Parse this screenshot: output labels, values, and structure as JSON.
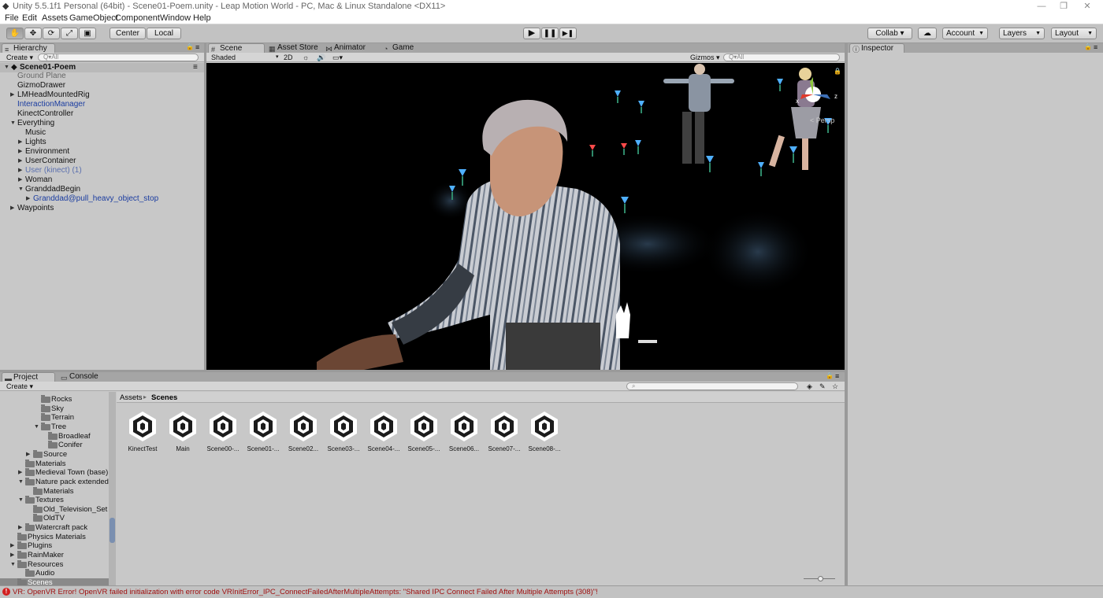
{
  "window": {
    "title": "Unity 5.5.1f1 Personal (64bit) - Scene01-Poem.unity - Leap Motion World - PC, Mac & Linux Standalone <DX11>",
    "min": "—",
    "max": "❐",
    "close": "✕"
  },
  "menu": [
    "File",
    "Edit",
    "Assets",
    "GameObject",
    "Component",
    "Window",
    "Help"
  ],
  "toolbar": {
    "pivot": "Center",
    "space": "Local",
    "collab": "Collab ▾",
    "account": "Account",
    "layers": "Layers",
    "layout": "Layout"
  },
  "hierarchy": {
    "tab": "Hierarchy",
    "create": "Create",
    "search_placeholder": "Q▾All",
    "scene": "Scene01-Poem",
    "items": [
      {
        "label": "Ground Plane",
        "indent": 0,
        "arrow": "",
        "color": "#666666"
      },
      {
        "label": "GizmoDrawer",
        "indent": 0,
        "arrow": "",
        "color": "#111111"
      },
      {
        "label": "LMHeadMountedRig",
        "indent": 0,
        "arrow": "▶",
        "color": "#111111"
      },
      {
        "label": "InteractionManager",
        "indent": 0,
        "arrow": "",
        "color": "#1a3ca0"
      },
      {
        "label": "KinectController",
        "indent": 0,
        "arrow": "",
        "color": "#111111"
      },
      {
        "label": "Everything",
        "indent": 0,
        "arrow": "▼",
        "color": "#111111"
      },
      {
        "label": "Music",
        "indent": 1,
        "arrow": "",
        "color": "#111111"
      },
      {
        "label": "Lights",
        "indent": 1,
        "arrow": "▶",
        "color": "#111111"
      },
      {
        "label": "Environment",
        "indent": 1,
        "arrow": "▶",
        "color": "#111111"
      },
      {
        "label": "UserContainer",
        "indent": 1,
        "arrow": "▶",
        "color": "#111111"
      },
      {
        "label": "User (kinect) (1)",
        "indent": 1,
        "arrow": "▶",
        "color": "#5a6fae"
      },
      {
        "label": "Woman",
        "indent": 1,
        "arrow": "▶",
        "color": "#111111"
      },
      {
        "label": "GranddadBegin",
        "indent": 1,
        "arrow": "▼",
        "color": "#111111"
      },
      {
        "label": "Granddad@pull_heavy_object_stop",
        "indent": 2,
        "arrow": "▶",
        "color": "#1a3ca0"
      },
      {
        "label": "Waypoints",
        "indent": 0,
        "arrow": "▶",
        "color": "#111111"
      }
    ]
  },
  "scene_view": {
    "tabs": [
      "Scene",
      "Asset Store",
      "Animator",
      "Game"
    ],
    "shading": "Shaded",
    "mode2d": "2D",
    "gizmos": "Gizmos",
    "search_placeholder": "Q▾All",
    "persp": "< Persp",
    "axis_z": "z",
    "axis_x": "x"
  },
  "inspector": {
    "tab": "Inspector"
  },
  "project": {
    "tabs": [
      "Project",
      "Console"
    ],
    "create": "Create",
    "breadcrumb_root": "Assets",
    "breadcrumb_sep": "▸",
    "breadcrumb_current": "Scenes",
    "tree": [
      {
        "label": "Rocks",
        "x": 55,
        "arrow": ""
      },
      {
        "label": "Sky",
        "x": 55,
        "arrow": ""
      },
      {
        "label": "Terrain",
        "x": 55,
        "arrow": ""
      },
      {
        "label": "Tree",
        "x": 55,
        "arrow": "▼"
      },
      {
        "label": "Broadleaf",
        "x": 64,
        "arrow": ""
      },
      {
        "label": "Conifer",
        "x": 64,
        "arrow": ""
      },
      {
        "label": "Source",
        "x": 45,
        "arrow": "▶"
      },
      {
        "label": "Materials",
        "x": 35,
        "arrow": ""
      },
      {
        "label": "Medieval Town (base)",
        "x": 35,
        "arrow": "▶"
      },
      {
        "label": "Nature pack extended",
        "x": 35,
        "arrow": "▼"
      },
      {
        "label": "Materials",
        "x": 45,
        "arrow": ""
      },
      {
        "label": "Textures",
        "x": 35,
        "arrow": "▼"
      },
      {
        "label": "Old_Television_Set",
        "x": 45,
        "arrow": ""
      },
      {
        "label": "OldTV",
        "x": 45,
        "arrow": ""
      },
      {
        "label": "Watercraft pack",
        "x": 35,
        "arrow": "▶"
      },
      {
        "label": "Physics Materials",
        "x": 25,
        "arrow": ""
      },
      {
        "label": "Plugins",
        "x": 25,
        "arrow": "▶"
      },
      {
        "label": "RainMaker",
        "x": 25,
        "arrow": "▶"
      },
      {
        "label": "Resources",
        "x": 25,
        "arrow": "▼"
      },
      {
        "label": "Audio",
        "x": 35,
        "arrow": ""
      },
      {
        "label": "Scenes",
        "x": 25,
        "arrow": ""
      }
    ],
    "assets": [
      "KinectTest",
      "Main",
      "Scene00-...",
      "Scene01-...",
      "Scene02...",
      "Scene03-...",
      "Scene04-...",
      "Scene05-...",
      "Scene06...",
      "Scene07-...",
      "Scene08-..."
    ]
  },
  "status": {
    "icon": "!",
    "message": "VR: OpenVR Error! OpenVR failed initialization with error code VRInitError_IPC_ConnectFailedAfterMultipleAttempts: \"Shared IPC Connect Failed After Multiple Attempts (308)\"!"
  },
  "colors": {
    "accent": "#3d6fb6",
    "error": "#c01a1a",
    "scene_bg": "#000000"
  }
}
